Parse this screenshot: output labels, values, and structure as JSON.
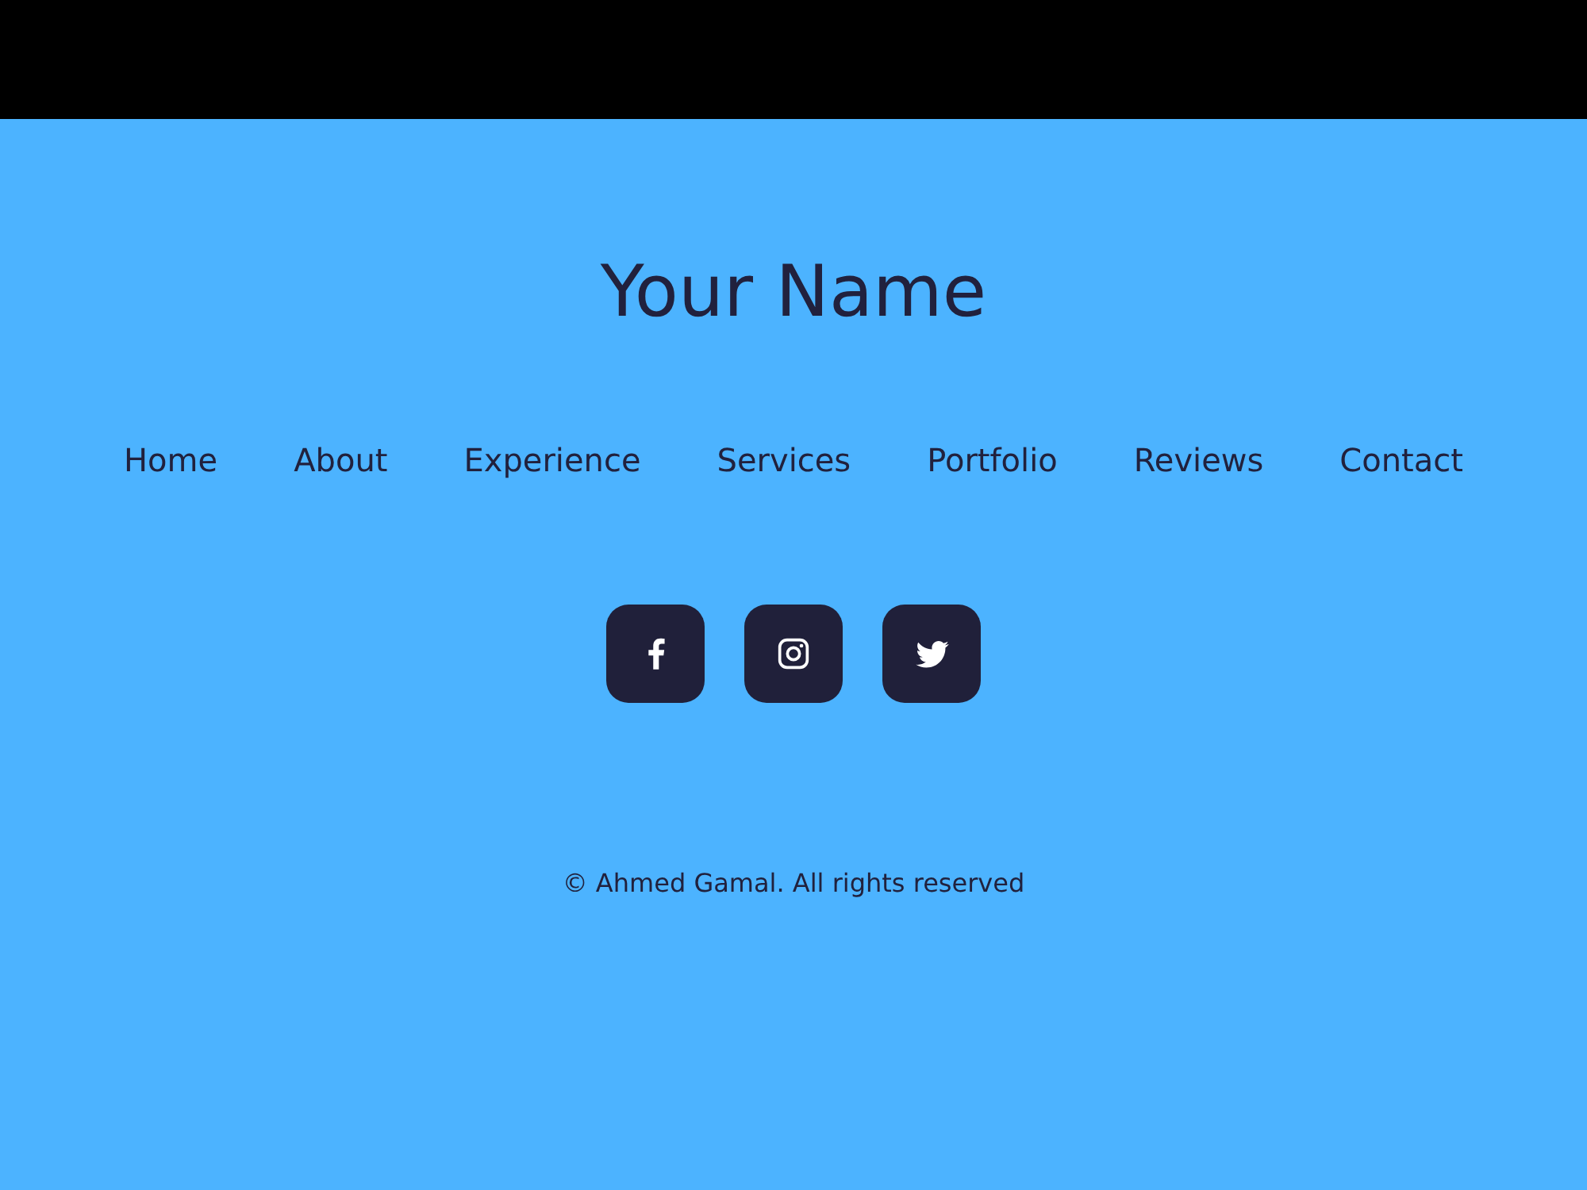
{
  "hero": {
    "title": "Your Name"
  },
  "nav": [
    {
      "label": "Home"
    },
    {
      "label": "About"
    },
    {
      "label": "Experience"
    },
    {
      "label": "Services"
    },
    {
      "label": "Portfolio"
    },
    {
      "label": "Reviews"
    },
    {
      "label": "Contact"
    }
  ],
  "social_links": [
    {
      "kind": "facebook"
    },
    {
      "kind": "instagram"
    },
    {
      "kind": "twitter"
    }
  ],
  "footer": {
    "copyright": "© Ahmed Gamal. All rights reserved"
  }
}
